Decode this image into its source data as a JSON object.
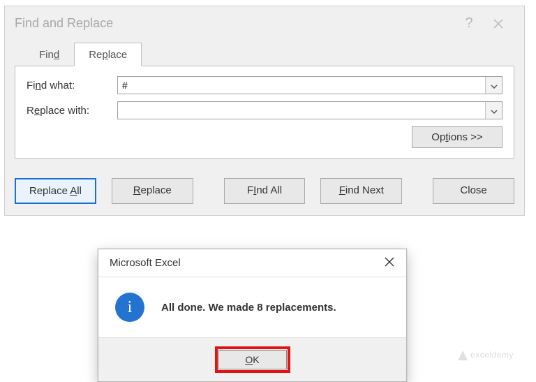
{
  "find_replace": {
    "title": "Find and Replace",
    "help": "?",
    "tabs": {
      "find": "Find",
      "find_accel": "d",
      "replace": "Replace",
      "replace_accel": "p"
    },
    "labels": {
      "find_what": "Find what:",
      "find_what_accel": "n",
      "replace_with": "Replace with:",
      "replace_with_accel": "e"
    },
    "values": {
      "find_what": "#",
      "replace_with": ""
    },
    "buttons": {
      "options": "Options >>",
      "options_accel": "t",
      "replace_all": "Replace All",
      "replace_all_accel": "A",
      "replace": "Replace",
      "replace_accel": "R",
      "find_all": "Find All",
      "find_all_accel": "I",
      "find_next": "Find Next",
      "find_next_accel": "F",
      "close": "Close"
    }
  },
  "msgbox": {
    "title": "Microsoft Excel",
    "message": "All done. We made 8 replacements.",
    "ok": "OK",
    "ok_accel": "O"
  },
  "watermark": "exceldemy"
}
